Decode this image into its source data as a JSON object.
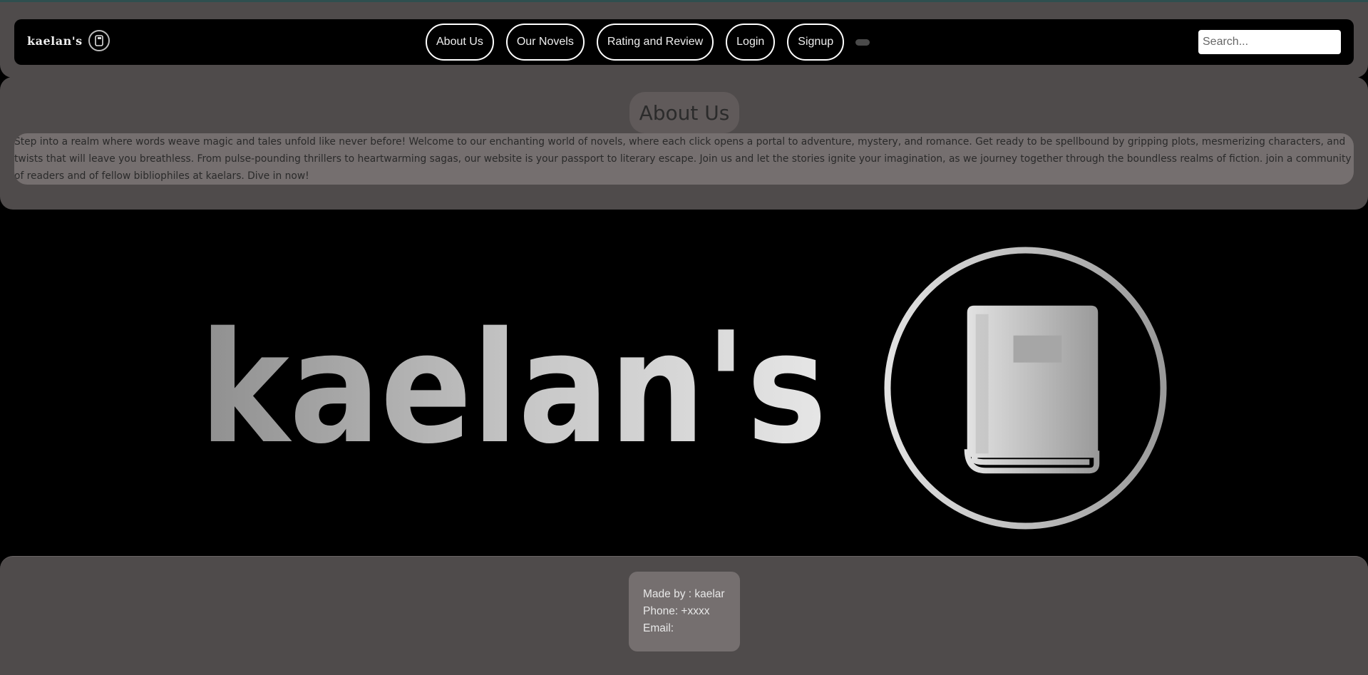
{
  "brand": {
    "name": "kaelan's"
  },
  "nav": {
    "items": [
      {
        "label": "About Us"
      },
      {
        "label": "Our Novels"
      },
      {
        "label": "Rating and Review"
      },
      {
        "label": "Login"
      },
      {
        "label": "Signup"
      }
    ],
    "search_placeholder": "Search..."
  },
  "about": {
    "title": "About Us",
    "text": "Step into a realm where words weave magic and tales unfold like never before! Welcome to our enchanting world of novels, where each click opens a portal to adventure, mystery, and romance. Get ready to be spellbound by gripping plots, mesmerizing characters, and twists that will leave you breathless. From pulse-pounding thrillers to heartwarming sagas, our website is your passport to literary escape. Join us and let the stories ignite your imagination, as we journey together through the boundless realms of fiction. join a community of readers and of fellow bibliophiles at kaelars. Dive in now!"
  },
  "hero": {
    "wordmark": "kaelan's",
    "emblem_icon": "book-icon"
  },
  "footer": {
    "made_by": "Made by : kaelar",
    "phone": "Phone: +xxxx",
    "email": "Email:"
  },
  "colors": {
    "band": "#4f4b4b",
    "card": "#756f6f",
    "navbar": "#000000"
  }
}
